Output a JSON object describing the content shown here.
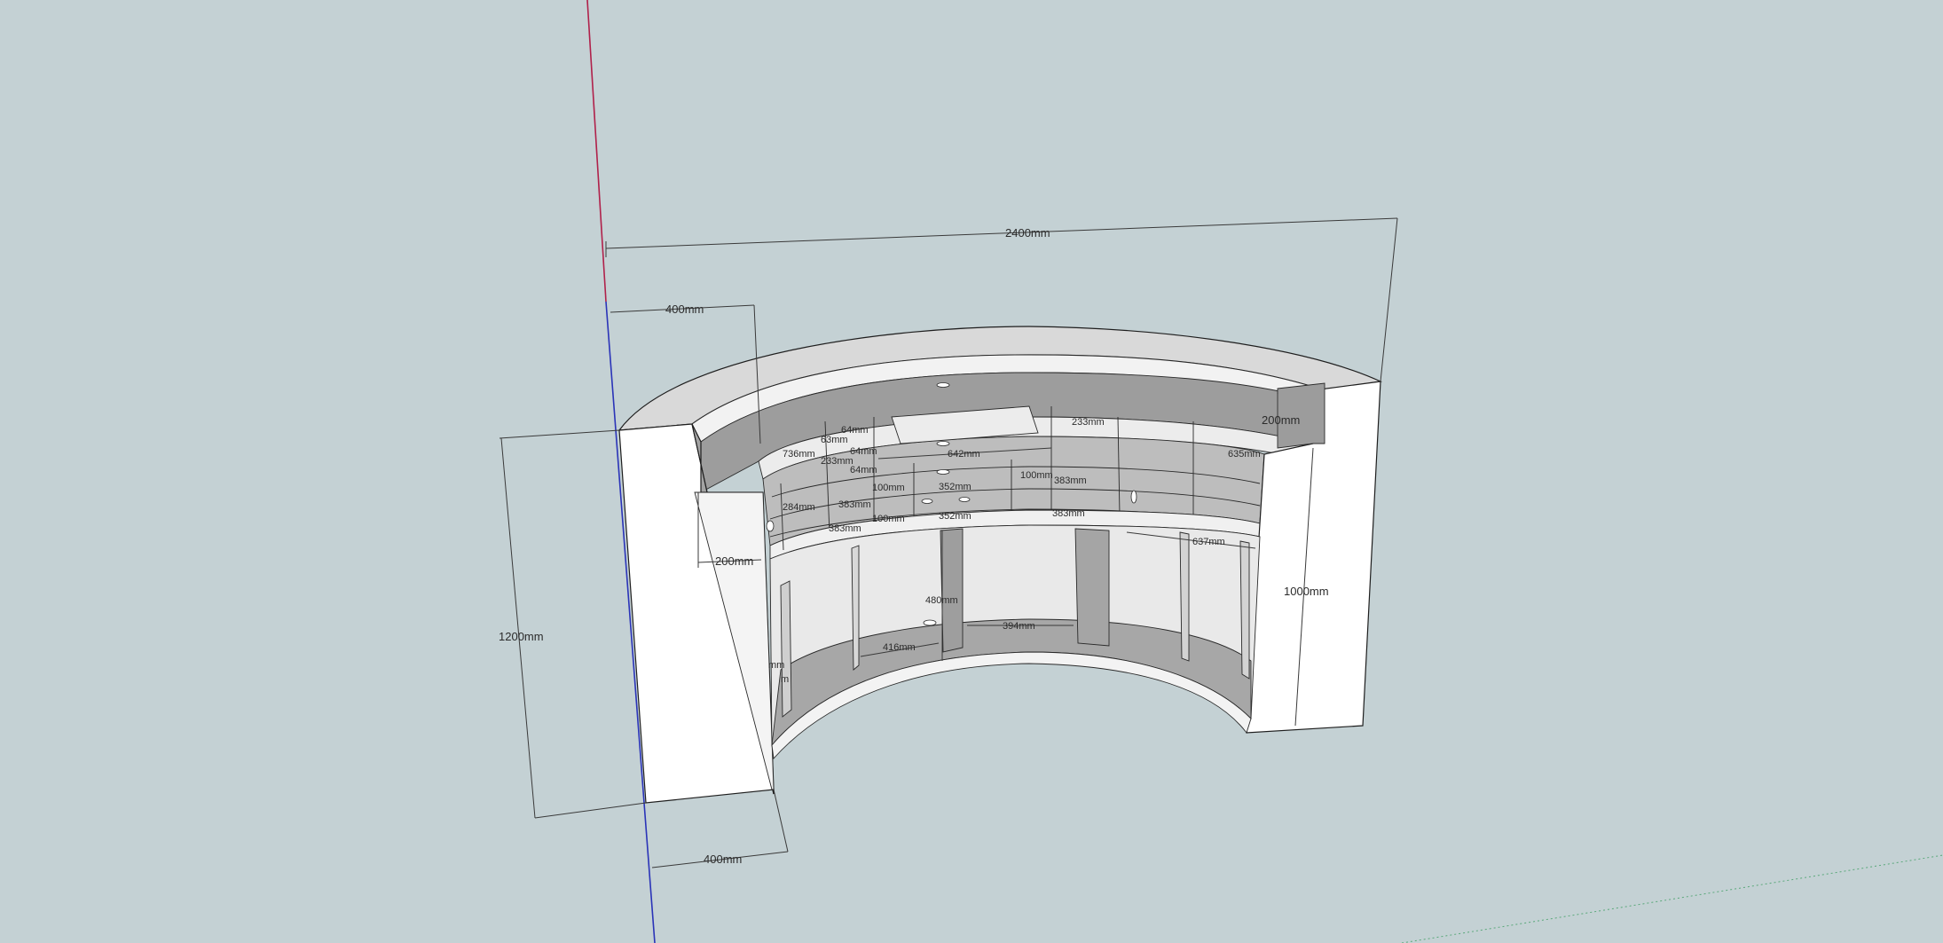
{
  "background_color": "#c4d1d4",
  "axes": {
    "red_axis_color": "#b0204a",
    "blue_axis_color": "#2a33b8",
    "green_axis_color": "#5aa87a"
  },
  "dimensions": {
    "overall_width": "2400mm",
    "top_left_depth": "400mm",
    "overall_height": "1200mm",
    "bottom_depth": "400mm",
    "inner_ledge": "200mm",
    "right_top_height": "200mm",
    "right_height": "1000mm",
    "left_shelf_width": "736mm",
    "left_shelf_height": "284mm",
    "small_a": "64mm",
    "small_b": "63mm",
    "small_c": "64mm",
    "small_d": "64mm",
    "shelf_233_left": "233mm",
    "shelf_233_right": "233mm",
    "center_span": "642mm",
    "right_span_top": "635mm",
    "right_span_low": "637mm",
    "mid_100a": "100mm",
    "mid_100b": "100mm",
    "mid_100c": "100mm",
    "mid_352a": "352mm",
    "mid_352b": "352mm",
    "left_383a": "383mm",
    "left_383b": "383mm",
    "right_383a": "383mm",
    "right_383b": "383mm",
    "lower_height": "480mm",
    "lower_416": "416mm",
    "lower_394": "394mm",
    "lower_left_cut": "mm",
    "lower_left_cut2": "m"
  }
}
